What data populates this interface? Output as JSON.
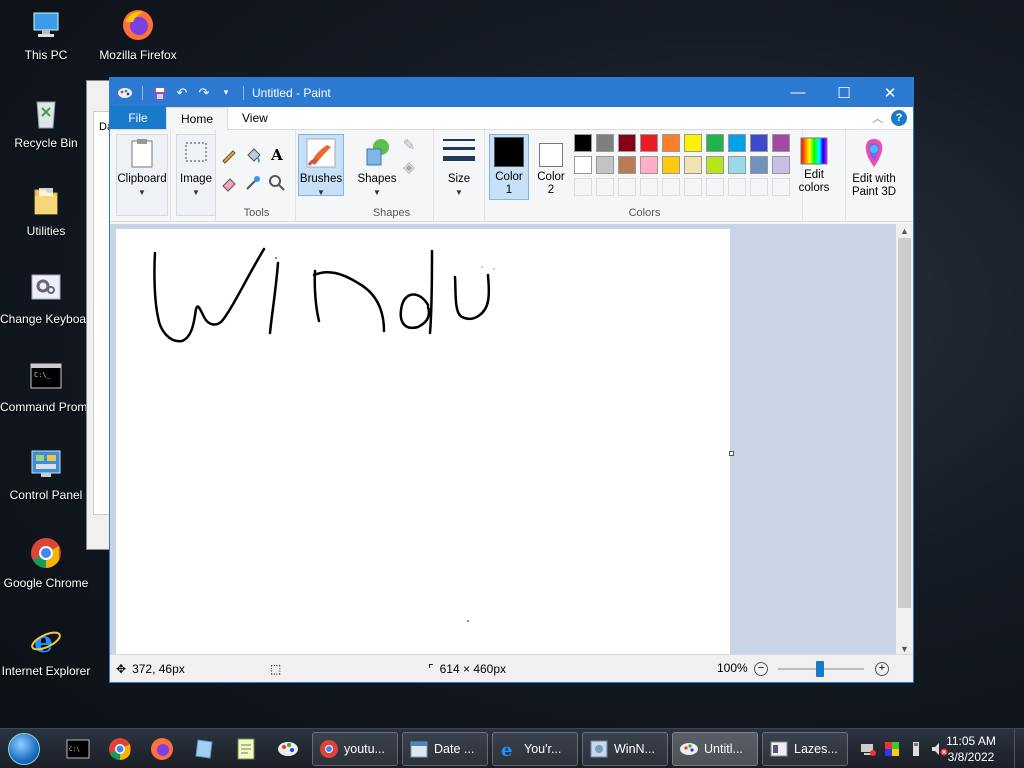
{
  "desktop": {
    "icons": [
      {
        "label": "This PC"
      },
      {
        "label": "Mozilla Firefox"
      },
      {
        "label": "Recycle Bin"
      },
      {
        "label": "Utilities"
      },
      {
        "label": "Change Keyboard Layout"
      },
      {
        "label": "Command Prompt"
      },
      {
        "label": "Control Panel"
      },
      {
        "label": "Google Chrome"
      },
      {
        "label": "Internet Explorer"
      }
    ],
    "background_window_text": "Da"
  },
  "paint": {
    "title": "Untitled - Paint",
    "tabs": {
      "file": "File",
      "home": "Home",
      "view": "View"
    },
    "ribbon": {
      "clipboard": "Clipboard",
      "image": "Image",
      "tools_group": "Tools",
      "brushes": "Brushes",
      "shapes": "Shapes",
      "shapes_group": "Shapes",
      "size": "Size",
      "color1_a": "Color",
      "color1_b": "1",
      "color2_a": "Color",
      "color2_b": "2",
      "edit_colors_a": "Edit",
      "edit_colors_b": "colors",
      "paint3d_a": "Edit with",
      "paint3d_b": "Paint 3D",
      "colors_group": "Colors"
    },
    "palette_row1": [
      "#000000",
      "#7f7f7f",
      "#880015",
      "#ed1c24",
      "#ff7f27",
      "#fff200",
      "#22b14c",
      "#00a2e8",
      "#3f48cc",
      "#a349a4"
    ],
    "palette_row2": [
      "#ffffff",
      "#c3c3c3",
      "#b97a57",
      "#ffaec9",
      "#ffc90e",
      "#efe4b0",
      "#b5e61d",
      "#99d9ea",
      "#7092be",
      "#c8bfe7"
    ],
    "color1": "#000000",
    "color2": "#ffffff",
    "status": {
      "cursor_pos": "372, 46px",
      "canvas_size": "614 × 460px",
      "zoom": "100%"
    }
  },
  "taskbar": {
    "buttons": [
      {
        "label": "youtu..."
      },
      {
        "label": "Date ..."
      },
      {
        "label": "You'r..."
      },
      {
        "label": "WinN..."
      },
      {
        "label": "Untitl..."
      },
      {
        "label": "Lazes..."
      }
    ],
    "time": "11:05 AM",
    "date": "3/8/2022"
  },
  "colors": {
    "accent": "#2b79d0",
    "file_tab": "#1979ca"
  }
}
